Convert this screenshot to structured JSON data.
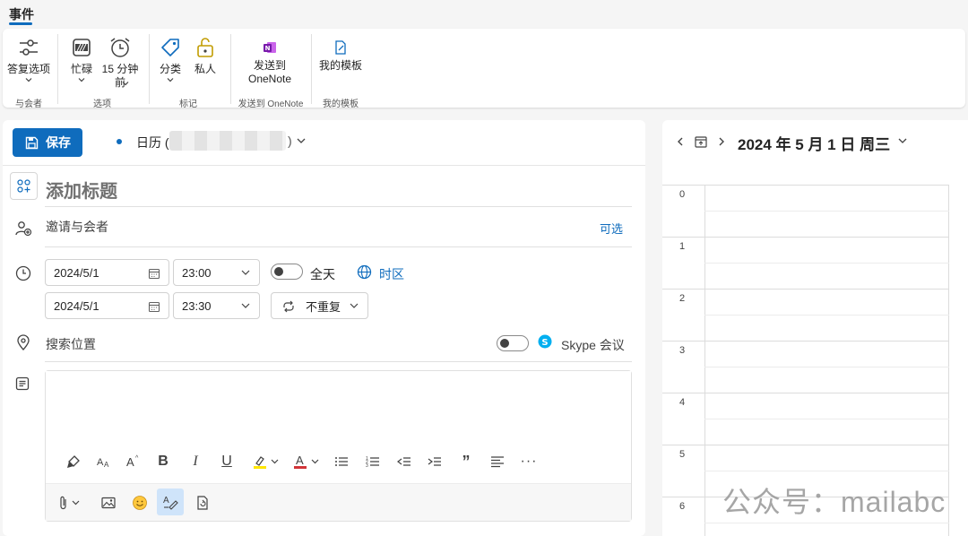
{
  "tabs": {
    "active": "事件"
  },
  "ribbon": {
    "reply_options": "答复选项",
    "attendees_group": "与会者",
    "busy": "忙碌",
    "reminder": "15 分钟\n前",
    "options_group": "选项",
    "categorize": "分类",
    "private": "私人",
    "tags_group": "标记",
    "send_onenote": "发送到\nOneNote",
    "onenote_group": "发送到 OneNote",
    "my_templates": "我的模板",
    "templates_group": "我的模板"
  },
  "form": {
    "save_label": "保存",
    "calendar_label": "日历 (",
    "calendar_close": ")",
    "title_placeholder": "添加标题",
    "attendees_placeholder": "邀请与会者",
    "optional_label": "可选",
    "start_date": "2024/5/1",
    "start_time": "23:00",
    "end_date": "2024/5/1",
    "end_time": "23:30",
    "all_day_label": "全天",
    "timezone_label": "时区",
    "repeat_label": "不重复",
    "location_placeholder": "搜索位置",
    "skype_label": "Skype 会议"
  },
  "calendar_panel": {
    "date_title": "2024 年 5 月 1 日 周三",
    "hours": [
      "0",
      "1",
      "2",
      "3",
      "4",
      "5",
      "6"
    ]
  },
  "watermark": "公众号：mailabc",
  "colors": {
    "accent": "#0f6cbd",
    "onenote": "#7719aa",
    "skype": "#00aff0",
    "highlight": "#ffe600",
    "font_color": "#d13438"
  }
}
